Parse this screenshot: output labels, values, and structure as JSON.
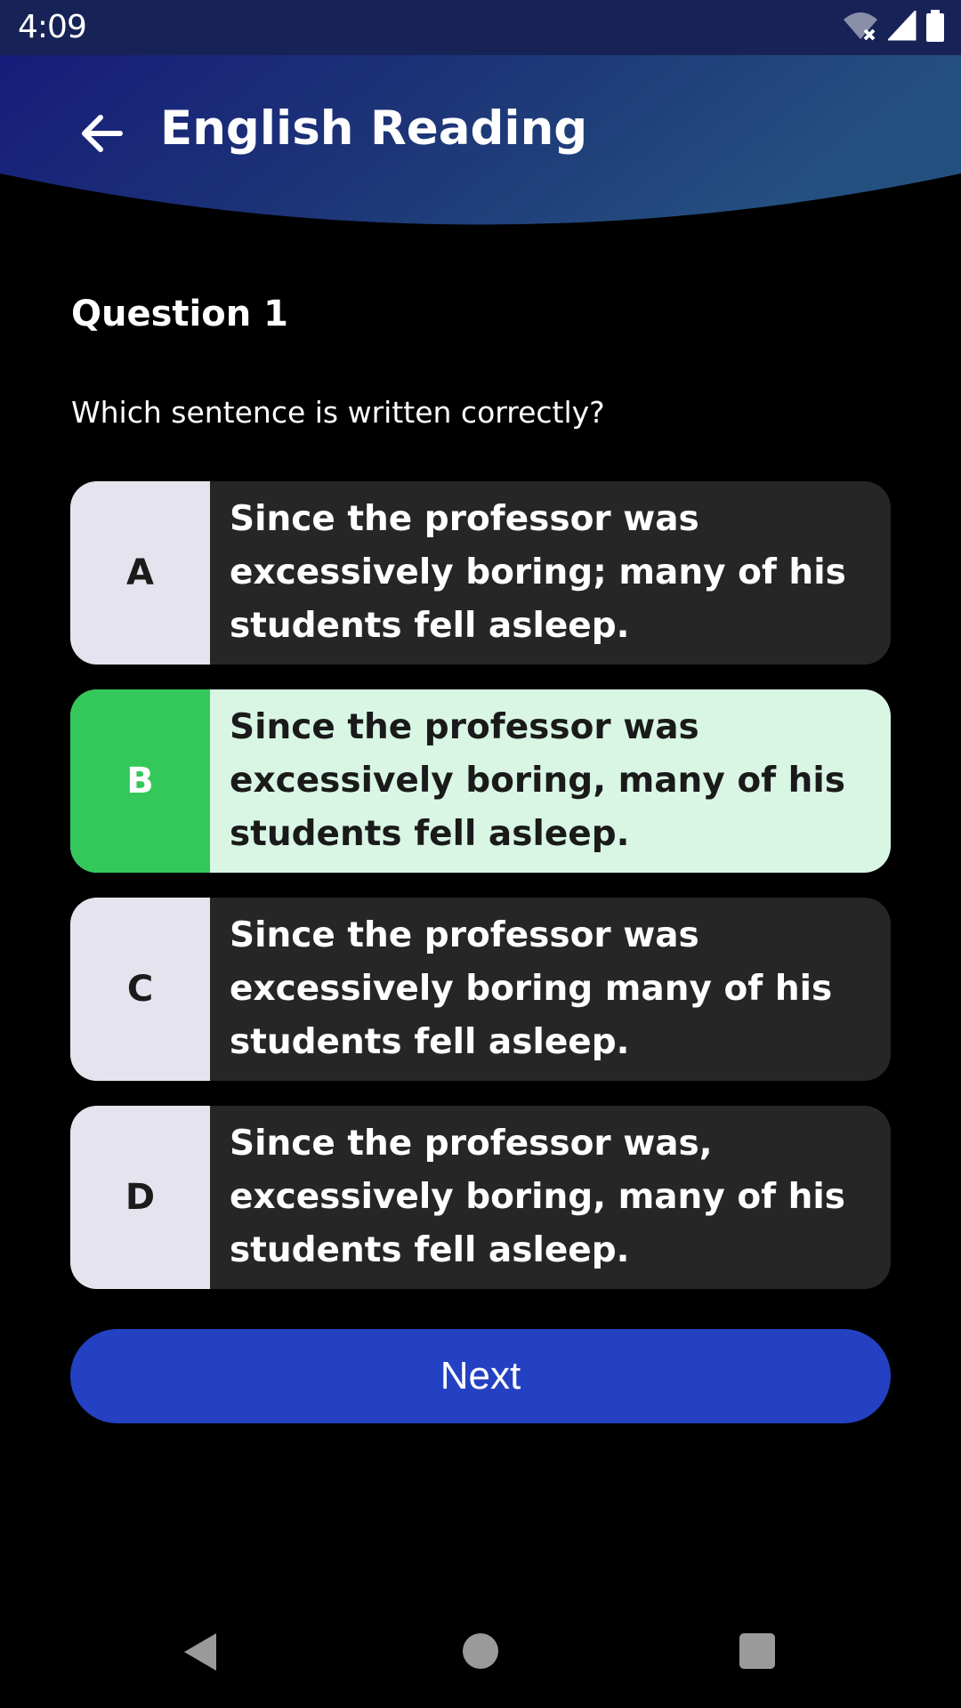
{
  "status_bar": {
    "time": "4:09",
    "icons": [
      "wifi-off-icon",
      "signal-icon",
      "battery-icon"
    ]
  },
  "app_bar": {
    "title": "English Reading",
    "back_icon": "arrow-left-icon"
  },
  "question": {
    "title": "Question 1",
    "prompt": "Which sentence is written correctly?"
  },
  "options": [
    {
      "letter": "A",
      "text": "Since the professor was excessively boring; many of his students fell asleep.",
      "selected": false
    },
    {
      "letter": "B",
      "text": "Since the professor was excessively boring, many of his students fell asleep.",
      "selected": true
    },
    {
      "letter": "C",
      "text": "Since the professor was excessively boring many of his students fell asleep.",
      "selected": false
    },
    {
      "letter": "D",
      "text": "Since the professor was, excessively boring, many of his students fell asleep.",
      "selected": false
    }
  ],
  "next_button": {
    "label": "Next"
  },
  "colors": {
    "header_start": "#15197a",
    "header_end": "#245080",
    "selected_letter": "#34c85a",
    "selected_body": "#d9f6e4",
    "option_body": "#262626",
    "letter_bg": "#e5e3ed",
    "button": "#2341c2"
  },
  "nav_bar": {
    "icons": [
      "nav-back-icon",
      "nav-home-icon",
      "nav-recents-icon"
    ]
  }
}
